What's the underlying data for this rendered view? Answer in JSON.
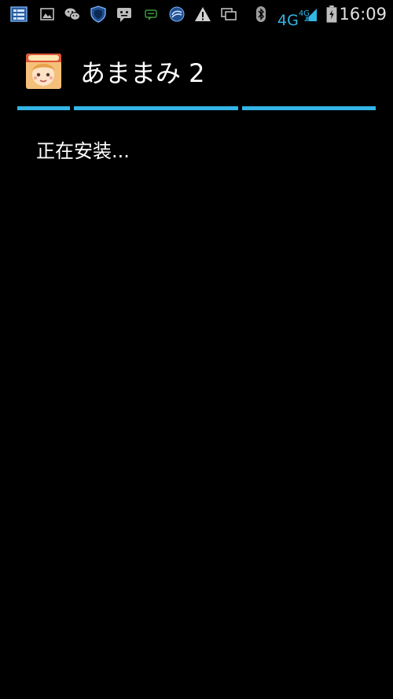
{
  "status_bar": {
    "icons": [
      "notification-list-icon",
      "gallery-icon",
      "wechat-icon",
      "shield-icon",
      "messenger-icon",
      "chat-icon",
      "sync-icon",
      "warning-icon",
      "window-icon",
      "bluetooth-icon",
      "signal-icon",
      "battery-icon"
    ],
    "network_label": "4G",
    "network_label_small": "4G",
    "time": "16:09",
    "accent_color": "#33b5e5"
  },
  "dialog": {
    "app_name": "あままみ 2",
    "status_text": "正在安装...",
    "divider_color": "#33b5e5"
  }
}
